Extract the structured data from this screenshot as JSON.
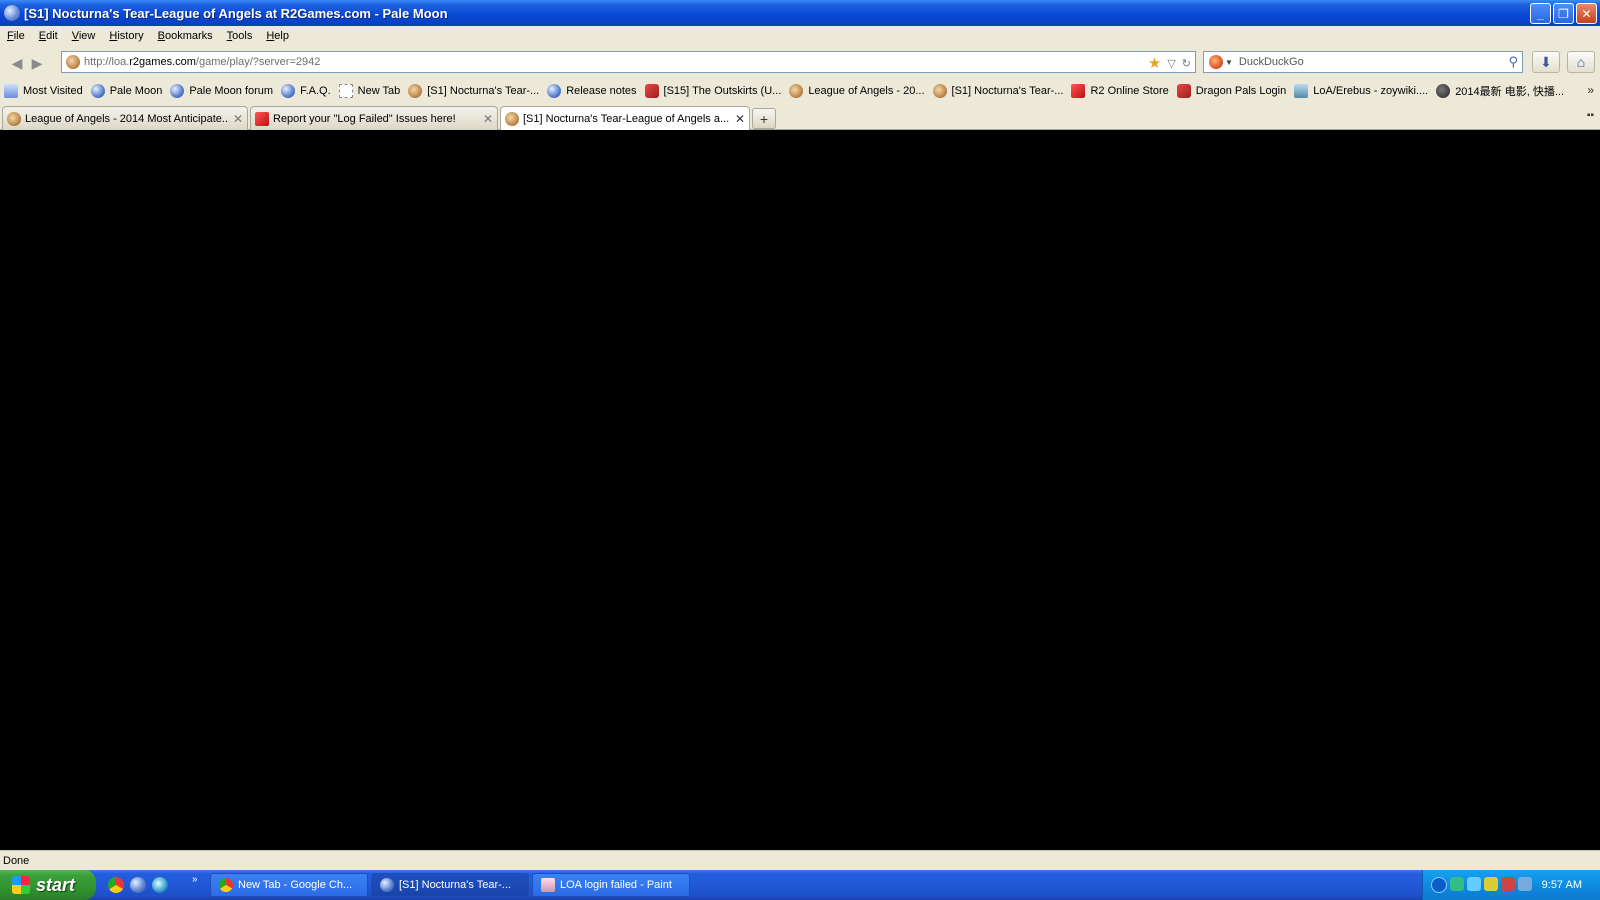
{
  "window": {
    "title": "[S1] Nocturna's Tear-League of Angels at R2Games.com - Pale Moon",
    "minimize": "_",
    "maximize": "❐",
    "close": "✕"
  },
  "menu": [
    "File",
    "Edit",
    "View",
    "History",
    "Bookmarks",
    "Tools",
    "Help"
  ],
  "menu_underline": [
    "F",
    "E",
    "V",
    "H",
    "B",
    "T",
    "H"
  ],
  "nav": {
    "url_prefix": "http://loa.",
    "url_domain": "r2games.com",
    "url_suffix": "/game/play/?server=2942",
    "search_placeholder": "DuckDuckGo"
  },
  "bookmarks": [
    {
      "label": "Most Visited",
      "icon": "mv"
    },
    {
      "label": "Pale Moon",
      "icon": "globe"
    },
    {
      "label": "Pale Moon forum",
      "icon": "globe"
    },
    {
      "label": "F.A.Q.",
      "icon": "globe"
    },
    {
      "label": "New Tab",
      "icon": "box"
    },
    {
      "label": "[S1] Nocturna's Tear-...",
      "icon": "face"
    },
    {
      "label": "Release notes",
      "icon": "globe"
    },
    {
      "label": "[S15] The Outskirts (U...",
      "icon": "red"
    },
    {
      "label": "League of Angels - 20...",
      "icon": "face"
    },
    {
      "label": "[S1] Nocturna's Tear-...",
      "icon": "face"
    },
    {
      "label": "R2 Online Store",
      "icon": "r2"
    },
    {
      "label": "Dragon Pals Login",
      "icon": "red"
    },
    {
      "label": "LoA/Erebus - zoywiki....",
      "icon": "wiki"
    },
    {
      "label": "2014最新 电影, 快播...",
      "icon": "dark"
    }
  ],
  "tabs": [
    {
      "label": "League of Angels - 2014 Most Anticipate...",
      "active": false
    },
    {
      "label": "Report your \"Log Failed\" Issues here!",
      "active": false
    },
    {
      "label": "[S1] Nocturna's Tear-League of Angels a...",
      "active": true
    }
  ],
  "status": "Done",
  "taskbar": {
    "start": "start",
    "quick_more": "»",
    "tasks": [
      {
        "label": "New Tab - Google Ch...",
        "active": false
      },
      {
        "label": "[S1] Nocturna's Tear-...",
        "active": true
      },
      {
        "label": "LOA login failed - Paint",
        "active": false
      }
    ],
    "clock": "9:57 AM"
  }
}
